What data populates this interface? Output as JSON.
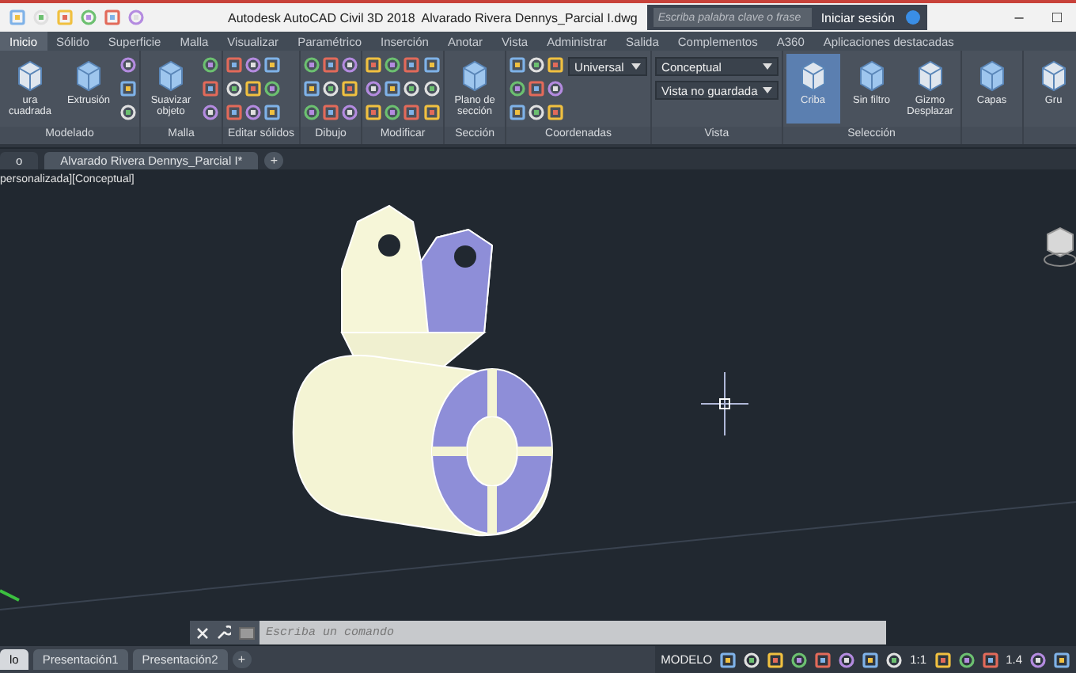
{
  "title_bar": {
    "app": "Autodesk AutoCAD Civil 3D 2018",
    "file": "Alvarado Rivera Dennys_Parcial I.dwg",
    "search": {
      "placeholder": "Escriba palabra clave o frase"
    },
    "sign_in": "Iniciar sesión",
    "window_buttons": [
      "–",
      "□"
    ]
  },
  "ribbon_tabs": [
    {
      "label": "Inicio",
      "selected": true
    },
    {
      "label": "Sólido",
      "selected": false
    },
    {
      "label": "Superficie",
      "selected": false
    },
    {
      "label": "Malla",
      "selected": false
    },
    {
      "label": "Visualizar",
      "selected": false
    },
    {
      "label": "Paramétrico",
      "selected": false
    },
    {
      "label": "Inserción",
      "selected": false
    },
    {
      "label": "Anotar",
      "selected": false
    },
    {
      "label": "Vista",
      "selected": false
    },
    {
      "label": "Administrar",
      "selected": false
    },
    {
      "label": "Salida",
      "selected": false
    },
    {
      "label": "Complementos",
      "selected": false
    },
    {
      "label": "A360",
      "selected": false
    },
    {
      "label": "Aplicaciones destacadas",
      "selected": false
    }
  ],
  "ribbon_panels": [
    {
      "label": "Modelado",
      "tools": [
        {
          "kind": "large",
          "label": "ura cuadrada"
        },
        {
          "kind": "large",
          "label": "Extrusión"
        },
        {
          "kind": "column"
        }
      ]
    },
    {
      "label": "Malla",
      "tools": [
        {
          "kind": "large",
          "label": "Suavizar objeto"
        },
        {
          "kind": "column"
        }
      ]
    },
    {
      "label": "Editar sólidos",
      "tools": [
        {
          "kind": "grid"
        }
      ]
    },
    {
      "label": "Dibujo",
      "tools": [
        {
          "kind": "grid"
        }
      ]
    },
    {
      "label": "Modificar",
      "tools": [
        {
          "kind": "grid"
        },
        {
          "kind": "column"
        }
      ]
    },
    {
      "label": "Sección",
      "tools": [
        {
          "kind": "large",
          "label": "Plano de sección"
        }
      ]
    },
    {
      "label": "Coordenadas",
      "tools": [
        {
          "kind": "grid"
        },
        {
          "kind": "dropdown",
          "value": "Universal"
        }
      ]
    },
    {
      "label": "Vista",
      "tools": [
        {
          "kind": "dropdown",
          "value": "Conceptual"
        },
        {
          "kind": "dropdown",
          "value": "Vista no guardada"
        }
      ]
    },
    {
      "label": "Selección",
      "tools": [
        {
          "kind": "large",
          "label": "Criba",
          "selected": true
        },
        {
          "kind": "large",
          "label": "Sin filtro",
          "selected": false
        },
        {
          "kind": "large",
          "label": "Gizmo Desplazar",
          "selected": false
        }
      ]
    },
    {
      "tools": [
        {
          "kind": "large",
          "label": "Capas"
        }
      ]
    },
    {
      "tools": [
        {
          "kind": "large",
          "label": "Gru"
        }
      ]
    }
  ],
  "file_tabs": [
    {
      "label": "o",
      "selected": false
    },
    {
      "label": "Alvarado Rivera Dennys_Parcial I*",
      "selected": true
    }
  ],
  "new_tab": "+",
  "viewport": {
    "label": "personalizada][Conceptual]"
  },
  "command_line": {
    "placeholder": "Escriba un comando"
  },
  "status_bar": {
    "layout_tabs": [
      {
        "label": "lo",
        "selected": true
      },
      {
        "label": "Presentación1",
        "selected": false
      },
      {
        "label": "Presentación2",
        "selected": false
      }
    ],
    "add_layout": "+",
    "model": "MODELO",
    "scale": "1:1",
    "annotation": "1.4"
  }
}
